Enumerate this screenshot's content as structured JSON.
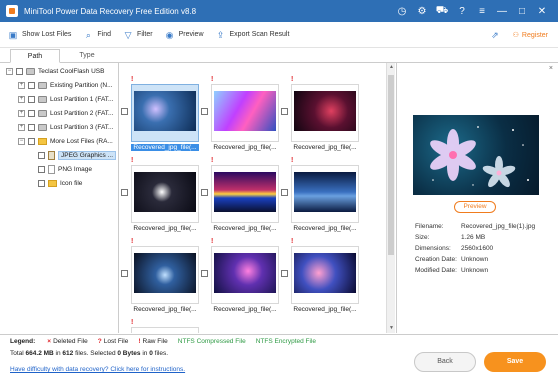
{
  "app": {
    "title": "MiniTool Power Data Recovery Free Edition v8.8"
  },
  "titlebar_icons": [
    "clock-icon",
    "settings-gear-icon",
    "cart-icon",
    "help-icon",
    "menu-icon",
    "minimize-icon",
    "restore-icon",
    "close-icon"
  ],
  "toolbar": {
    "show_lost_files": "Show Lost Files",
    "find": "Find",
    "filter": "Filter",
    "preview": "Preview",
    "export_scan_result": "Export Scan Result",
    "register": "Register"
  },
  "tabs": [
    {
      "label": "Path"
    },
    {
      "label": "Type"
    }
  ],
  "tree": {
    "items": [
      {
        "label": "Teclast CoolFlash USB"
      },
      {
        "label": "Existing Partition (N..."
      },
      {
        "label": "Lost Partition 1 (FAT..."
      },
      {
        "label": "Lost Partition 2 (FAT..."
      },
      {
        "label": "Lost Partition 3 (FAT..."
      },
      {
        "label": "More Lost Files (RA..."
      },
      {
        "label": "JPEG Graphics ..."
      },
      {
        "label": "PNG Image"
      },
      {
        "label": "Icon file"
      }
    ]
  },
  "files": [
    {
      "name": "Recovered_jpg_file(...",
      "mark": "!"
    },
    {
      "name": "Recovered_jpg_file(...",
      "mark": "!"
    },
    {
      "name": "Recovered_jpg_file(...",
      "mark": "!"
    },
    {
      "name": "Recovered_jpg_file(...",
      "mark": "!"
    },
    {
      "name": "Recovered_jpg_file(...",
      "mark": "!"
    },
    {
      "name": "Recovered_jpg_file(...",
      "mark": "!"
    },
    {
      "name": "Recovered_jpg_file(...",
      "mark": "!"
    },
    {
      "name": "Recovered_jpg_file(...",
      "mark": "!"
    },
    {
      "name": "Recovered_jpg_file(...",
      "mark": "!"
    },
    {
      "mark": "!"
    }
  ],
  "preview": {
    "button": "Preview",
    "close": "×",
    "rows": [
      {
        "key": "Filename:",
        "value": "Recovered_jpg_file(1).jpg"
      },
      {
        "key": "Size:",
        "value": "1.26 MB"
      },
      {
        "key": "Dimensions:",
        "value": "2560x1600"
      },
      {
        "key": "Creation Date:",
        "value": "Unknown"
      },
      {
        "key": "Modified Date:",
        "value": "Unknown"
      }
    ]
  },
  "legend": {
    "title": "Legend:",
    "deleted": "Deleted File",
    "lost": "Lost File",
    "raw": "Raw File",
    "ntfs_compressed": "NTFS Compressed File",
    "ntfs_encrypted": "NTFS Encrypted File",
    "deleted_mark": "×",
    "lost_mark": "?",
    "raw_mark": "!"
  },
  "status": {
    "total_label": "Total",
    "total_size": "664.2 MB",
    "in_label": "in",
    "total_files": "612",
    "files_label": "files.",
    "selected_label": "Selected",
    "selected_size": "0 Bytes",
    "in_label2": "in",
    "selected_files": "0",
    "files_label2": "files."
  },
  "help_link": "Have difficulty with data recovery? Click here for instructions.",
  "buttons": {
    "back": "Back",
    "save": "Save"
  },
  "colors": {
    "titlebar": "#2e6fb5",
    "accent": "#f7921e",
    "link": "#1e62c9",
    "ntfs": "#2e9a44",
    "mark": "#e0262b"
  }
}
